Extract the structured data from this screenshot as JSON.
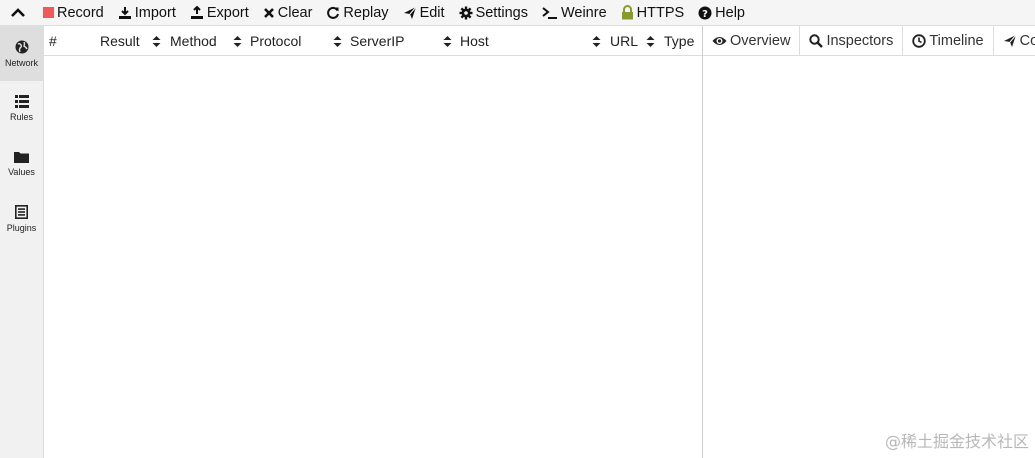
{
  "menu": {
    "items": [
      {
        "label": "Record",
        "icon": "record-icon"
      },
      {
        "label": "Import",
        "icon": "import-icon"
      },
      {
        "label": "Export",
        "icon": "export-icon"
      },
      {
        "label": "Clear",
        "icon": "clear-icon"
      },
      {
        "label": "Replay",
        "icon": "replay-icon"
      },
      {
        "label": "Edit",
        "icon": "edit-icon"
      },
      {
        "label": "Settings",
        "icon": "gear-icon"
      },
      {
        "label": "Weinre",
        "icon": "terminal-icon"
      },
      {
        "label": "HTTPS",
        "icon": "lock-icon"
      },
      {
        "label": "Help",
        "icon": "help-icon"
      }
    ]
  },
  "sidebar": {
    "items": [
      {
        "label": "Network",
        "icon": "globe-icon"
      },
      {
        "label": "Rules",
        "icon": "list-icon"
      },
      {
        "label": "Values",
        "icon": "folder-icon"
      },
      {
        "label": "Plugins",
        "icon": "plugin-icon"
      }
    ]
  },
  "table": {
    "columns": [
      "#",
      "Result",
      "Method",
      "Protocol",
      "ServerIP",
      "Host",
      "URL",
      "Type"
    ]
  },
  "detail": {
    "tabs": [
      {
        "label": "Overview",
        "icon": "eye-icon"
      },
      {
        "label": "Inspectors",
        "icon": "search-icon"
      },
      {
        "label": "Timeline",
        "icon": "clock-icon"
      },
      {
        "label": "Composer",
        "icon": "send-icon"
      }
    ]
  },
  "watermark": "@稀土掘金技术社区",
  "colors": {
    "record": "#ee5a5a",
    "lock": "#8a9a2a",
    "menubar_bg": "#f5f5f5",
    "sidebar_bg": "#f1f1f1"
  }
}
